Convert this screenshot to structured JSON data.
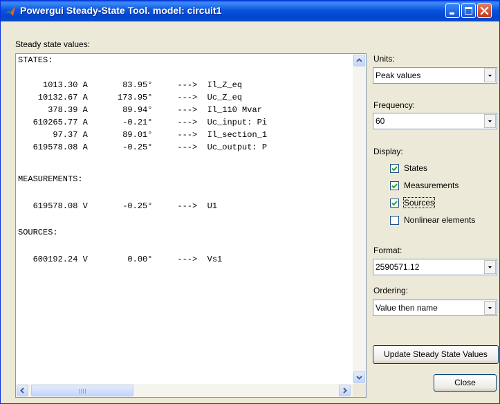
{
  "window": {
    "title": "Powergui Steady-State Tool. model: circuit1"
  },
  "main": {
    "label": "Steady state values:",
    "lines": [
      "STATES:",
      "",
      "     1013.30 A       83.95°     --->  Il_Z_eq",
      "    10132.67 A      173.95°     --->  Uc_Z_eq",
      "      378.39 A       89.94°     --->  Il_110 Mvar",
      "   610265.77 A       -0.21°     --->  Uc_input: Pi",
      "       97.37 A       89.01°     --->  Il_section_1",
      "   619578.08 A       -0.25°     --->  Uc_output: P",
      "",
      "MEASUREMENTS:",
      "",
      "   619578.08 V       -0.25°     --->  U1",
      "",
      "SOURCES:",
      "",
      "   600192.24 V        0.00°     --->  Vs1"
    ]
  },
  "units": {
    "label": "Units:",
    "value": "Peak values"
  },
  "frequency": {
    "label": "Frequency:",
    "value": "60"
  },
  "display": {
    "label": "Display:",
    "options": [
      {
        "label": "States",
        "checked": true
      },
      {
        "label": "Measurements",
        "checked": true
      },
      {
        "label": "Sources",
        "checked": true
      },
      {
        "label": "Nonlinear elements",
        "checked": false
      }
    ]
  },
  "format": {
    "label": "Format:",
    "value": "2590571.12"
  },
  "ordering": {
    "label": "Ordering:",
    "value": "Value then name"
  },
  "buttons": {
    "update": "Update Steady State Values",
    "close": "Close"
  },
  "colors": {
    "titlebar": "#0a55de",
    "window_bg": "#ece9d8",
    "check_mark": "#21a121",
    "scroll_arrow": "#4d6185"
  }
}
